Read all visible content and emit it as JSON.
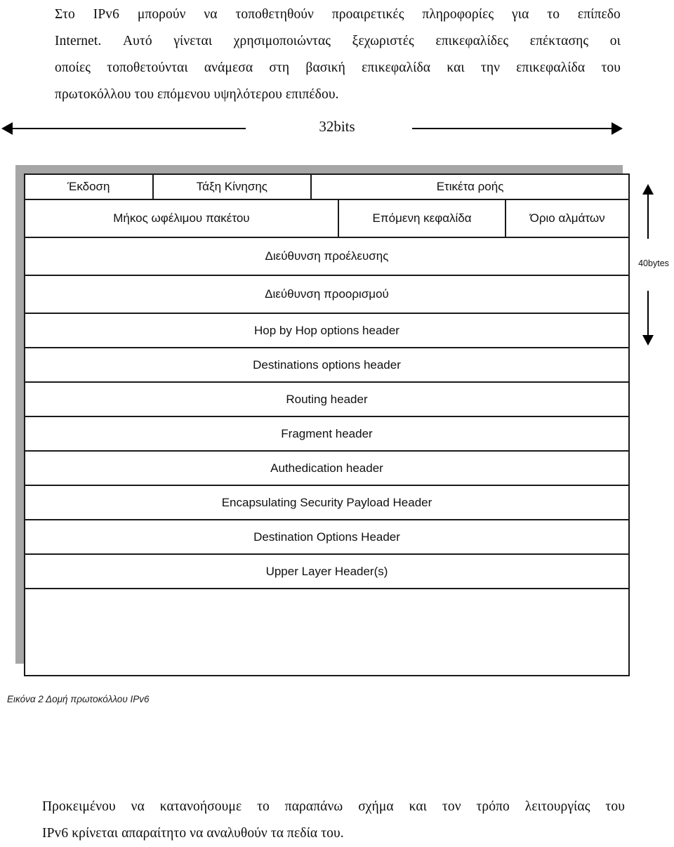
{
  "document": {
    "intro_paragraph": {
      "lines": [
        [
          "Στο",
          "IPv6",
          "μπορούν",
          "να",
          "τοποθετηθούν",
          "προαιρετικές",
          "πληροφορίες",
          "για",
          "το",
          "επίπεδο"
        ],
        [
          "Internet.",
          "Αυτό",
          "γίνεται",
          "χρησιμοποιώντας",
          "ξεχωριστές",
          "επικεφαλίδες",
          "επέκτασης",
          "οι"
        ],
        [
          "οποίες",
          "τοποθετούνται",
          "ανάμεσα",
          "στη",
          "βασική",
          "επικεφαλίδα",
          "και",
          "την",
          "επικεφαλίδα",
          "του"
        ],
        [
          "πρωτοκόλλου του επόμενου υψηλότερου επιπέδου."
        ]
      ]
    },
    "closing_paragraph": {
      "lines": [
        [
          "Προκειμένου",
          "να",
          "κατανοήσουμε",
          "το",
          "παραπάνω",
          "σχήμα",
          "και",
          "τον",
          "τρόπο",
          "λειτουργίας",
          "του"
        ],
        [
          "IPv6 κρίνεται απαραίτητο να αναλυθούν τα πεδία του."
        ]
      ]
    },
    "figure_caption": "Εικόνα 2 Δομή πρωτοκόλλου IPv6"
  },
  "diagram": {
    "width_indicator": {
      "label": "32bits",
      "left_arrow_icon": "arrow-left-icon",
      "right_arrow_icon": "arrow-right-icon"
    },
    "height_indicator": {
      "label": "40bytes",
      "up_arrow_icon": "arrow-up-icon",
      "down_arrow_icon": "arrow-down-icon"
    },
    "rows": [
      {
        "type": "three-column",
        "cells": [
          {
            "label": "Έκδοση",
            "span": 3
          },
          {
            "label": "Τάξη Κίνησης",
            "span": 3
          },
          {
            "label": "Ετικέτα ροής",
            "span": 7
          }
        ]
      },
      {
        "type": "three-column",
        "cells": [
          {
            "label": "Μήκος ωφέλιμου πακέτου",
            "span": 7
          },
          {
            "label": "Επόμενη κεφαλίδα",
            "span": 3
          },
          {
            "label": "Όριο αλμάτων",
            "span": 3
          }
        ]
      },
      {
        "type": "full",
        "label": "Διεύθυνση προέλευσης"
      },
      {
        "type": "full",
        "label": "Διεύθυνση προορισμού"
      },
      {
        "type": "full",
        "label": "Hop by Hop options header"
      },
      {
        "type": "full",
        "label": "Destinations options header"
      },
      {
        "type": "full",
        "label": "Routing header"
      },
      {
        "type": "full",
        "label": "Fragment header"
      },
      {
        "type": "full",
        "label": "Authedication header"
      },
      {
        "type": "full",
        "label": "Encapsulating Security Payload Header"
      },
      {
        "type": "full",
        "label": "Destination Options Header"
      },
      {
        "type": "full",
        "label": "Upper Layer Header(s)"
      },
      {
        "type": "full",
        "label": ""
      }
    ]
  },
  "colors": {
    "shadow": "#a6a6a6",
    "border": "#1a1a1a",
    "text": "#111111",
    "background": "#ffffff"
  }
}
